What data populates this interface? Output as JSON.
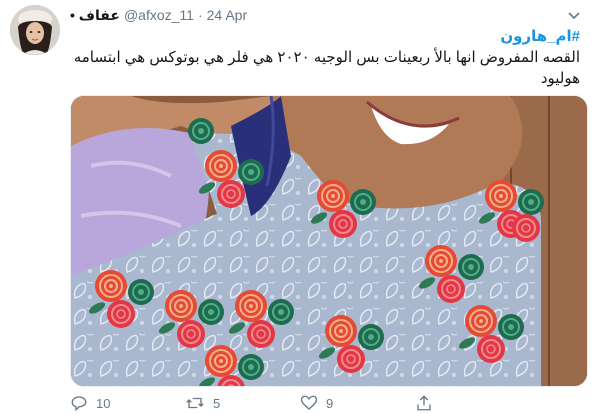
{
  "tweet": {
    "author_name": "عفاف •",
    "handle": "@afxoz_11",
    "separator": "·",
    "date": "24 Apr",
    "hashtag": "#ام_هارون",
    "text_line1": "القصه المفروض انها بالأ ربعينات بس الوجيه ٢٠٢٠ هي فلر هي بوتوكس هي  ابتسامه",
    "text_line2": "هوليود"
  },
  "actions": {
    "reply_count": "10",
    "retweet_count": "5",
    "like_count": "9"
  },
  "icons": {
    "avatar": "profile-avatar",
    "menu": "chevron-down-icon",
    "reply": "reply-icon",
    "retweet": "retweet-icon",
    "like": "heart-icon",
    "share": "share-icon"
  },
  "colors": {
    "hashtag": "#1b95e0",
    "muted": "#657786",
    "text": "#14171a"
  }
}
